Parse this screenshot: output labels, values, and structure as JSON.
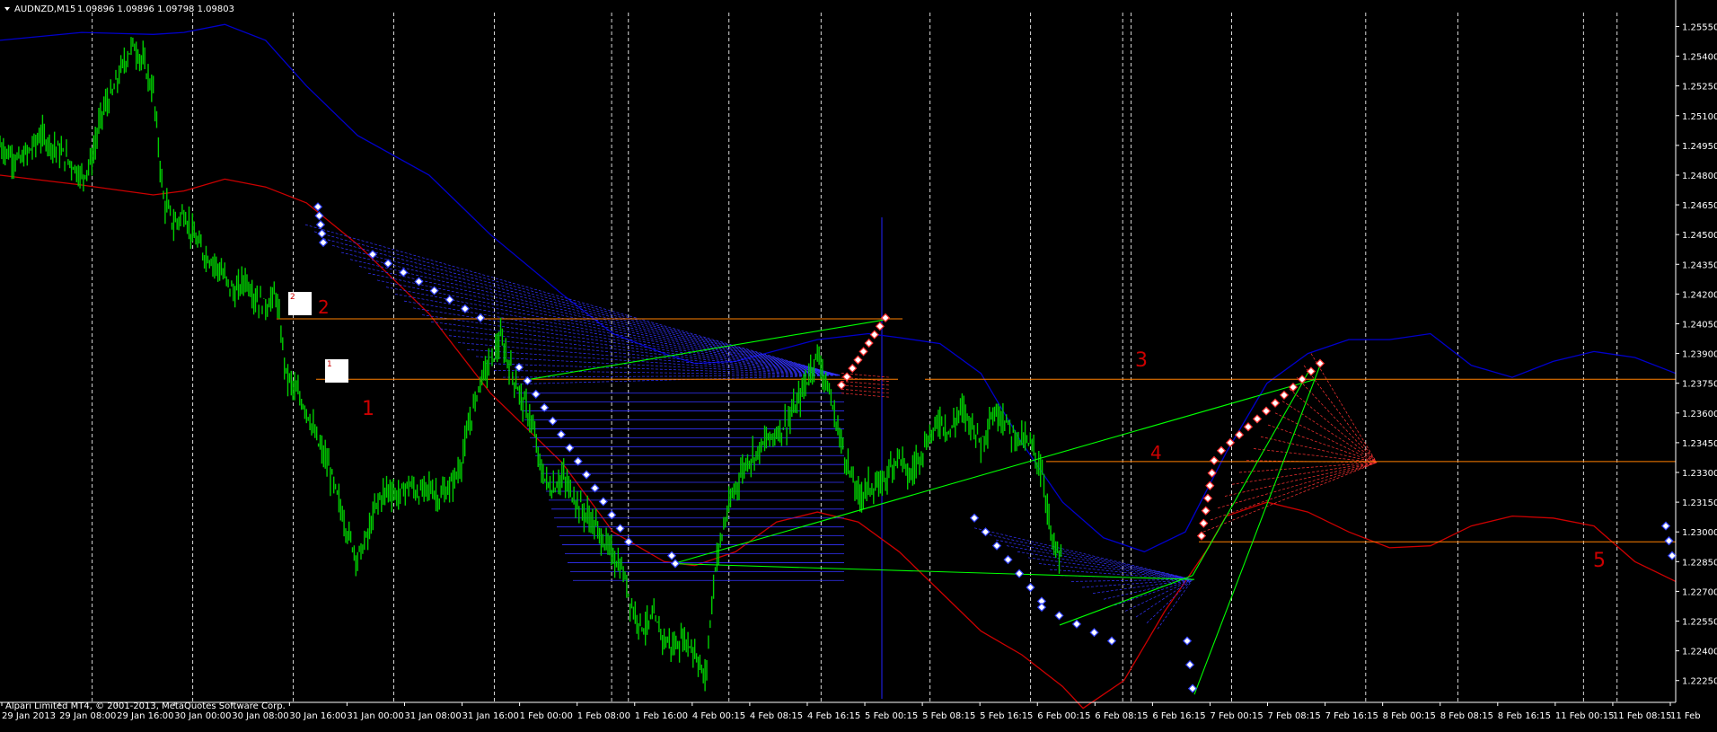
{
  "header": {
    "symbol_timeframe": "AUDNZD,M15",
    "ohlc": "1.09896 1.09896 1.09798 1.09803"
  },
  "footer": {
    "copyright": "Alpari Limited MT4, © 2001-2013, MetaQuotes Software Corp."
  },
  "colors": {
    "background": "#000000",
    "price_bars": "#00cc00",
    "upper_band": "#0000cc",
    "lower_band": "#cc0000",
    "level_lines": "#ff8000",
    "pattern_lines": "#00ff00",
    "fan_blue": "#3333ff",
    "fan_red": "#ff3333",
    "annotation": "#cc0000",
    "axis_text": "#ffffff"
  },
  "chart_data": {
    "type": "line",
    "instrument": "AUDNZD",
    "timeframe": "M15",
    "y_axis_ticks": [
      "1.25550",
      "1.25400",
      "1.25250",
      "1.25100",
      "1.24950",
      "1.24800",
      "1.24650",
      "1.24500",
      "1.24350",
      "1.24200",
      "1.24050",
      "1.23900",
      "1.23750",
      "1.23600",
      "1.23450",
      "1.23300",
      "1.23150",
      "1.23000",
      "1.22850",
      "1.22700",
      "1.22550",
      "1.22400",
      "1.22250"
    ],
    "x_axis_ticks": [
      "29 Jan 2013",
      "29 Jan 08:00",
      "29 Jan 16:00",
      "30 Jan 00:00",
      "30 Jan 08:00",
      "30 Jan 16:00",
      "31 Jan 00:00",
      "31 Jan 08:00",
      "31 Jan 16:00",
      "1 Feb 00:00",
      "1 Feb 08:00",
      "1 Feb 16:00",
      "4 Feb 00:15",
      "4 Feb 08:15",
      "4 Feb 16:15",
      "5 Feb 00:15",
      "5 Feb 08:15",
      "5 Feb 16:15",
      "6 Feb 00:15",
      "6 Feb 08:15",
      "6 Feb 16:15",
      "7 Feb 00:15",
      "7 Feb 08:15",
      "7 Feb 16:15",
      "8 Feb 00:15",
      "8 Feb 08:15",
      "8 Feb 16:15",
      "11 Feb 00:15",
      "11 Feb 08:15",
      "11 Feb"
    ],
    "y_range": [
      1.2214,
      1.2562
    ],
    "grid": "vertical dashed session separators",
    "annotations": [
      "1",
      "2",
      "3",
      "4",
      "5"
    ],
    "box_labels": [
      "1",
      "2"
    ],
    "level_lines": [
      1.24075,
      1.2377,
      1.23355,
      1.2295
    ],
    "price_path": [
      [
        0,
        1.2495
      ],
      [
        1,
        1.249
      ],
      [
        2,
        1.2487
      ],
      [
        3,
        1.2493
      ],
      [
        4,
        1.25
      ],
      [
        5,
        1.2496
      ],
      [
        6,
        1.2491
      ],
      [
        7,
        1.2486
      ],
      [
        8,
        1.2479
      ],
      [
        9,
        1.2488
      ],
      [
        10,
        1.2512
      ],
      [
        11,
        1.2521
      ],
      [
        12,
        1.2535
      ],
      [
        13,
        1.2546
      ],
      [
        14,
        1.2537
      ],
      [
        15,
        1.2522
      ],
      [
        16,
        1.2468
      ],
      [
        17,
        1.2455
      ],
      [
        18,
        1.2461
      ],
      [
        19,
        1.2448
      ],
      [
        20,
        1.244
      ],
      [
        21,
        1.2436
      ],
      [
        22,
        1.2428
      ],
      [
        23,
        1.242
      ],
      [
        24,
        1.2428
      ],
      [
        25,
        1.2418
      ],
      [
        26,
        1.2414
      ],
      [
        27,
        1.242
      ],
      [
        28,
        1.238
      ],
      [
        29,
        1.237
      ],
      [
        30,
        1.2362
      ],
      [
        31,
        1.2346
      ],
      [
        32,
        1.2335
      ],
      [
        33,
        1.2318
      ],
      [
        34,
        1.23
      ],
      [
        35,
        1.2287
      ],
      [
        36,
        1.2298
      ],
      [
        37,
        1.2316
      ],
      [
        38,
        1.2322
      ],
      [
        39,
        1.2318
      ],
      [
        40,
        1.2324
      ],
      [
        41,
        1.2319
      ],
      [
        42,
        1.2323
      ],
      [
        43,
        1.2317
      ],
      [
        44,
        1.2322
      ],
      [
        45,
        1.2332
      ],
      [
        46,
        1.2355
      ],
      [
        47,
        1.2377
      ],
      [
        48,
        1.2386
      ],
      [
        49,
        1.2397
      ],
      [
        50,
        1.2382
      ],
      [
        51,
        1.2368
      ],
      [
        52,
        1.2356
      ],
      [
        53,
        1.233
      ],
      [
        54,
        1.2321
      ],
      [
        55,
        1.2328
      ],
      [
        56,
        1.2319
      ],
      [
        57,
        1.2311
      ],
      [
        58,
        1.2305
      ],
      [
        59,
        1.2296
      ],
      [
        60,
        1.2288
      ],
      [
        61,
        1.2279
      ],
      [
        62,
        1.226
      ],
      [
        63,
        1.2252
      ],
      [
        64,
        1.2256
      ],
      [
        65,
        1.2246
      ],
      [
        66,
        1.2242
      ],
      [
        67,
        1.2246
      ],
      [
        68,
        1.224
      ],
      [
        69,
        1.2225
      ],
      [
        70,
        1.2283
      ],
      [
        71,
        1.2306
      ],
      [
        72,
        1.2323
      ],
      [
        73,
        1.2335
      ],
      [
        74,
        1.234
      ],
      [
        75,
        1.2346
      ],
      [
        76,
        1.235
      ],
      [
        77,
        1.2355
      ],
      [
        78,
        1.2364
      ],
      [
        79,
        1.2377
      ],
      [
        80,
        1.239
      ],
      [
        81,
        1.2373
      ],
      [
        82,
        1.2352
      ],
      [
        83,
        1.2333
      ],
      [
        84,
        1.2318
      ],
      [
        85,
        1.2323
      ],
      [
        86,
        1.2322
      ],
      [
        87,
        1.2331
      ],
      [
        88,
        1.234
      ],
      [
        89,
        1.2327
      ],
      [
        90,
        1.2339
      ],
      [
        91,
        1.2348
      ],
      [
        92,
        1.2357
      ],
      [
        93,
        1.235
      ],
      [
        94,
        1.2362
      ],
      [
        95,
        1.2356
      ],
      [
        96,
        1.2345
      ],
      [
        97,
        1.2358
      ],
      [
        98,
        1.236
      ],
      [
        99,
        1.235
      ],
      [
        100,
        1.2347
      ],
      [
        101,
        1.2343
      ],
      [
        102,
        1.233
      ],
      [
        103,
        1.2294
      ],
      [
        104,
        1.2285
      ]
    ],
    "upper_band": [
      [
        0,
        1.2548
      ],
      [
        8,
        1.2552
      ],
      [
        15,
        1.2551
      ],
      [
        18,
        1.2552
      ],
      [
        22,
        1.2556
      ],
      [
        26,
        1.2548
      ],
      [
        30,
        1.2525
      ],
      [
        35,
        1.25
      ],
      [
        42,
        1.248
      ],
      [
        48,
        1.245
      ],
      [
        55,
        1.242
      ],
      [
        60,
        1.24
      ],
      [
        65,
        1.239
      ],
      [
        68,
        1.2385
      ],
      [
        72,
        1.2386
      ],
      [
        80,
        1.2397
      ],
      [
        85,
        1.24
      ],
      [
        88,
        1.2398
      ],
      [
        92,
        1.2395
      ],
      [
        96,
        1.238
      ],
      [
        100,
        1.2345
      ],
      [
        104,
        1.2315
      ],
      [
        108,
        1.2297
      ],
      [
        112,
        1.229
      ],
      [
        116,
        1.23
      ],
      [
        120,
        1.234
      ],
      [
        124,
        1.2375
      ],
      [
        128,
        1.239
      ],
      [
        132,
        1.2397
      ],
      [
        136,
        1.2397
      ],
      [
        140,
        1.24
      ],
      [
        144,
        1.2384
      ],
      [
        148,
        1.2378
      ],
      [
        152,
        1.2386
      ],
      [
        156,
        1.2391
      ],
      [
        160,
        1.2388
      ],
      [
        164,
        1.238
      ]
    ],
    "lower_band": [
      [
        0,
        1.248
      ],
      [
        8,
        1.2475
      ],
      [
        15,
        1.247
      ],
      [
        18,
        1.2472
      ],
      [
        22,
        1.2478
      ],
      [
        26,
        1.2474
      ],
      [
        30,
        1.2466
      ],
      [
        35,
        1.2445
      ],
      [
        42,
        1.241
      ],
      [
        48,
        1.237
      ],
      [
        55,
        1.2335
      ],
      [
        60,
        1.23
      ],
      [
        65,
        1.2285
      ],
      [
        68,
        1.2283
      ],
      [
        72,
        1.229
      ],
      [
        76,
        1.2305
      ],
      [
        80,
        1.231
      ],
      [
        84,
        1.2305
      ],
      [
        88,
        1.229
      ],
      [
        92,
        1.227
      ],
      [
        96,
        1.225
      ],
      [
        100,
        1.2238
      ],
      [
        104,
        1.2222
      ],
      [
        106,
        1.2211
      ],
      [
        110,
        1.2225
      ],
      [
        114,
        1.226
      ],
      [
        118,
        1.229
      ],
      [
        120,
        1.2308
      ],
      [
        124,
        1.2315
      ],
      [
        128,
        1.231
      ],
      [
        132,
        1.23
      ],
      [
        136,
        1.2292
      ],
      [
        140,
        1.2293
      ],
      [
        144,
        1.2303
      ],
      [
        148,
        1.2308
      ],
      [
        152,
        1.2307
      ],
      [
        156,
        1.2303
      ],
      [
        160,
        1.2285
      ],
      [
        164,
        1.2275
      ]
    ]
  }
}
